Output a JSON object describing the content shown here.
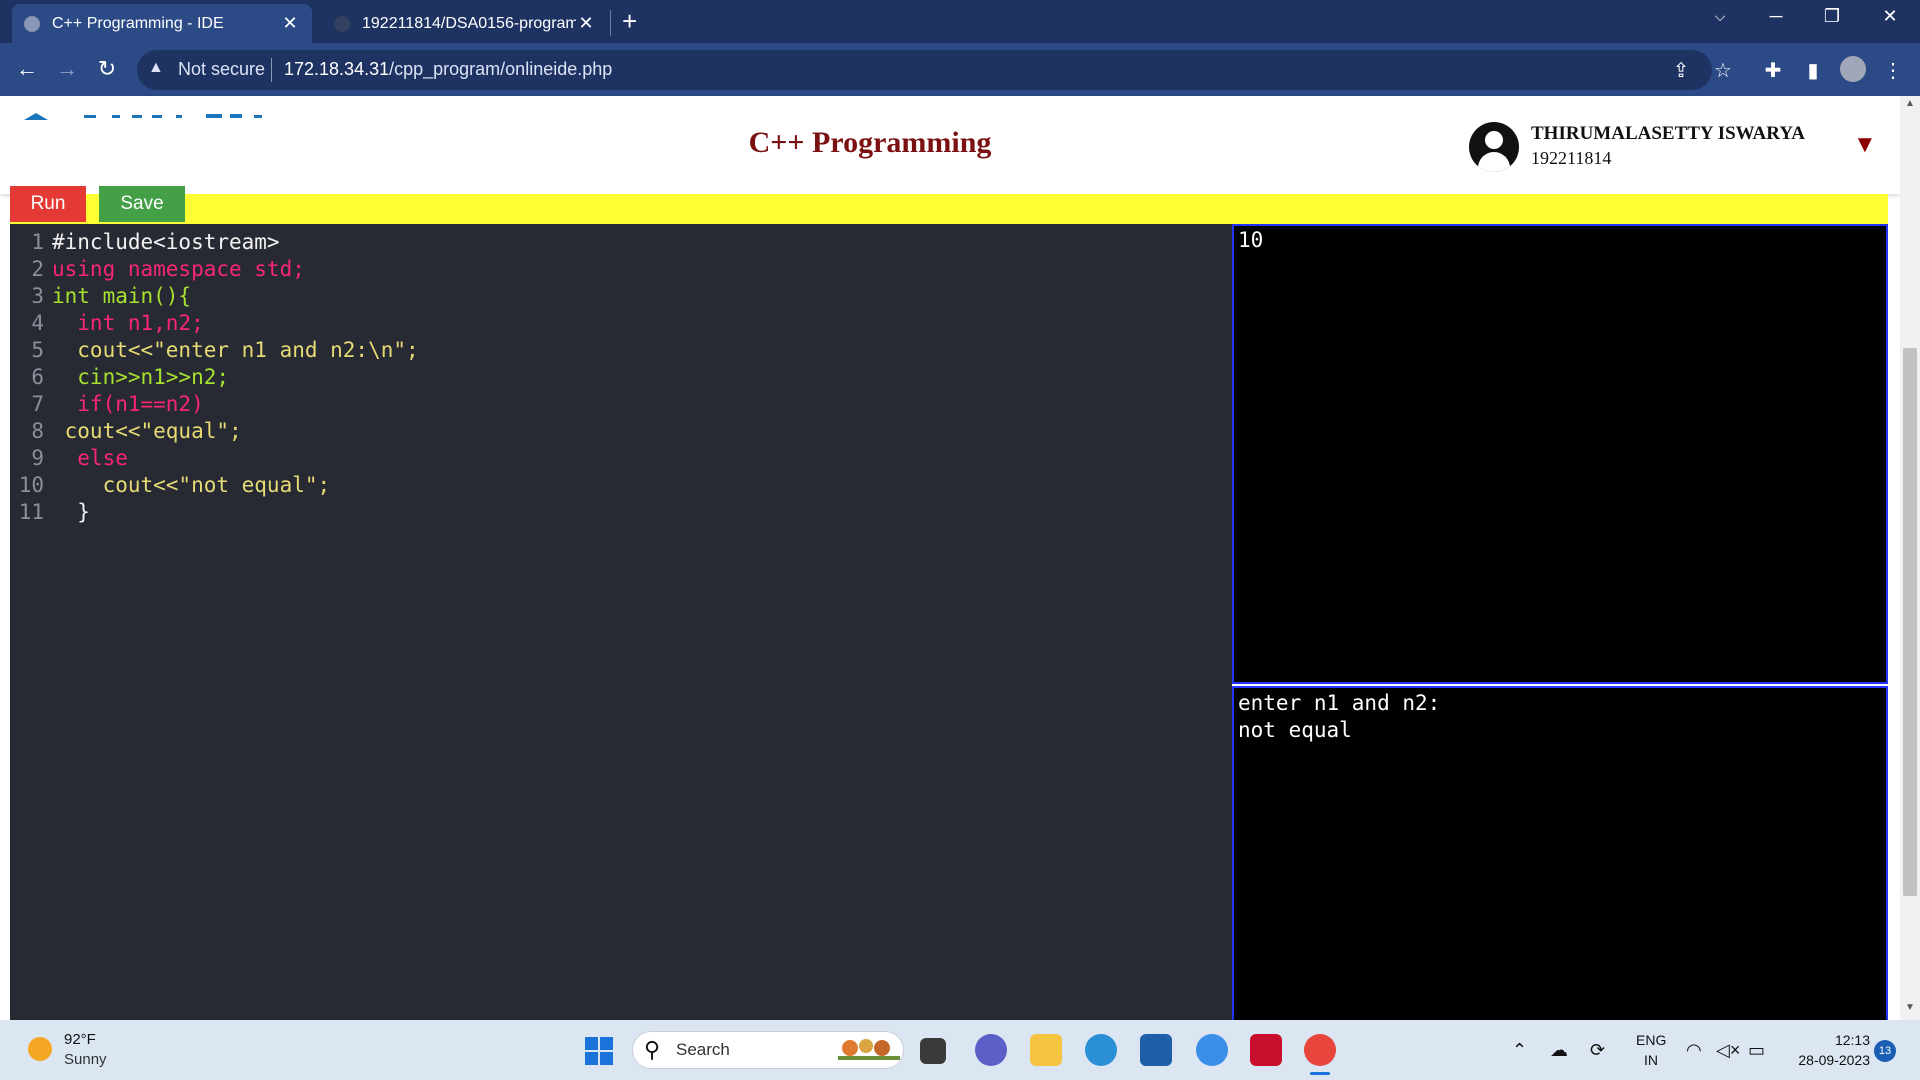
{
  "browser": {
    "tabs": [
      {
        "title": "C++ Programming - IDE",
        "active": true
      },
      {
        "title": "192211814/DSA0156-programm",
        "active": false
      }
    ],
    "new_tab_symbol": "+",
    "address": {
      "security_label": "Not secure",
      "host": "172.18.34.31",
      "path": "/cpp_program/onlineide.php"
    }
  },
  "header": {
    "title": "C++ Programming",
    "user_name": "THIRUMALASETTY ISWARYA",
    "user_id": "192211814",
    "menu_arrow": "▼"
  },
  "actions": {
    "run_label": "Run",
    "save_label": "Save"
  },
  "editor": {
    "line_numbers": [
      "1",
      "2",
      "3",
      "4",
      "5",
      "6",
      "7",
      "8",
      "9",
      "10",
      "11"
    ],
    "lines": [
      "#include<iostream>",
      "using namespace std;",
      "int main(){",
      "  int n1,n2;",
      "  cout<<\"enter n1 and n2:\\n\";",
      "  cin>>n1>>n2;",
      "  if(n1==n2)",
      " cout<<\"equal\";",
      "  else",
      "    cout<<\"not equal\";",
      "  }"
    ]
  },
  "input_panel": {
    "text": "10"
  },
  "output_panel": {
    "lines": [
      "enter n1 and n2:",
      "not equal"
    ]
  },
  "taskbar": {
    "weather_temp": "92°F",
    "weather_condition": "Sunny",
    "search_label": "Search",
    "lang_line1": "ENG",
    "lang_line2": "IN",
    "time": "12:13",
    "date": "28-09-2023",
    "notification_count": "13"
  },
  "colors": {
    "page_title": "#7a1010",
    "run_button": "#e53935",
    "save_button": "#43a047",
    "action_bar": "#ffff33",
    "editor_bg": "#272a33",
    "keyword": "#f92672",
    "type_green": "#a6e22e",
    "string_yellow": "#e6db74",
    "panel_border": "#2233ff"
  },
  "icons": [
    "back-icon",
    "forward-icon",
    "reload-icon",
    "warning-icon",
    "share-icon",
    "star-icon",
    "extensions-icon",
    "sidepanel-icon",
    "profile-icon",
    "menu-icon",
    "windows-start-icon",
    "search-icon",
    "taskview-icon",
    "meet-icon",
    "file-explorer-icon",
    "edge-icon",
    "store-icon",
    "help-icon",
    "mcafee-icon",
    "chrome-icon",
    "wifi-icon",
    "volume-icon",
    "battery-icon"
  ]
}
